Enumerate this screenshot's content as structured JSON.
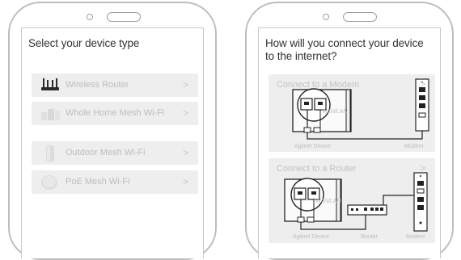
{
  "screen1": {
    "title": "Select your device type",
    "items": [
      {
        "label": "Wireless Router",
        "icon": "wireless-router-icon"
      },
      {
        "label": "Whole Home Mesh Wi-Fi",
        "icon": "mesh-wifi-icon"
      },
      {
        "label": "Outdoor Mesh Wi-Fi",
        "icon": "outdoor-mesh-icon"
      },
      {
        "label": "PoE Mesh Wi-Fi",
        "icon": "poe-mesh-icon"
      }
    ],
    "chevron": ">"
  },
  "screen2": {
    "title": "How will you connect your device to the internet?",
    "cards": [
      {
        "label": "Connect to a Modem",
        "captions": [
          "Agilnet Device",
          "Modem"
        ]
      },
      {
        "label": "Connect to a Router",
        "captions": [
          "Agilnet Device",
          "Router",
          "Modem"
        ]
      }
    ],
    "port_text": "WAN/LAN",
    "chevron": ">"
  }
}
